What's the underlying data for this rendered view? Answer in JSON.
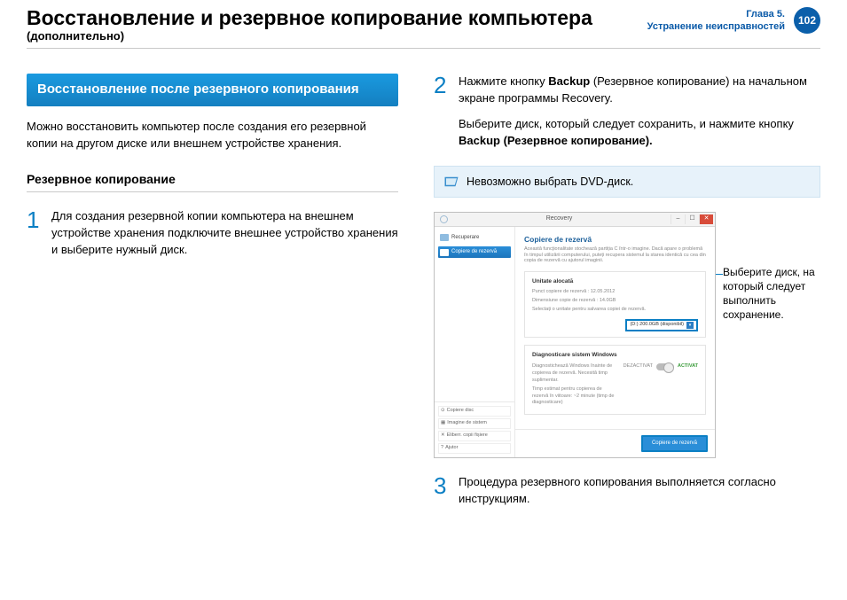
{
  "header": {
    "title": "Восстановление и резервное копирование компьютера",
    "subtitle": "(дополнительно)",
    "chapter_line1": "Глава 5.",
    "chapter_line2": "Устранение неисправностей",
    "page_number": "102"
  },
  "left": {
    "banner": "Восстановление после резервного копирования",
    "intro": "Можно восстановить компьютер после создания его резервной копии на другом диске или внешнем устройстве хранения.",
    "subhead": "Резервное копирование",
    "step1_num": "1",
    "step1": "Для создания резервной копии компьютера на внешнем устройстве хранения подключите внешнее устройство хранения и выберите нужный диск."
  },
  "right": {
    "step2_num": "2",
    "step2_a": "Нажмите кнопку ",
    "step2_b": "Backup",
    "step2_c": " (Резервное копирование) на начальном экране программы Recovery.",
    "step2_line2a": "Выберите диск, который следует сохранить, и нажмите кнопку ",
    "step2_line2b": "Backup (Резервное копирование).",
    "note": "Невозможно выбрать DVD-диск.",
    "callout": "Выберите диск, на который следует выполнить сохранение.",
    "step3_num": "3",
    "step3": "Процедура резервного копирования выполняется согласно инструкциям."
  },
  "recovery_window": {
    "title": "Recovery",
    "side_item_1": "Recuperare",
    "side_item_2": "Copiere de rezervă",
    "main_title": "Copiere de rezervă",
    "main_desc": "Această funcționalitate stochează partiția C într-o imagine. Dacă apare o problemă în timpul utilizării computerului, puteți recupera sistemul la starea identică cu cea din copia de rezervă cu ajutorul imaginii.",
    "panel1_h": "Unitate alocată",
    "panel1_l1": "Punct copiere de rezervă : 12.05.2012",
    "panel1_l2": "Dimensiune copie de rezervă : 14.0GB",
    "panel1_l3": "Selectați o unitate pentru salvarea copiei de rezervă.",
    "drive": "(D:) 200.0GB (disponibil)",
    "panel2_h": "Diagnosticare sistem Windows",
    "panel2_l1": "Diagnostichează Windows înainte de copierea de rezervă. Necesită timp suplimentar.",
    "panel2_l2": "Timp estimat pentru copierea de rezervă în viitoare: ~2 minute (timp de diagnosticare)",
    "toggle_off": "DEZACTIVAT",
    "toggle_on": "ACTIVAT",
    "bottom_1": "Copiere disc",
    "bottom_2": "Imagine de sistem",
    "bottom_3": "Eliberr. copii fișiere",
    "bottom_4": "Ajutor",
    "cta": "Copiere de rezervă"
  }
}
